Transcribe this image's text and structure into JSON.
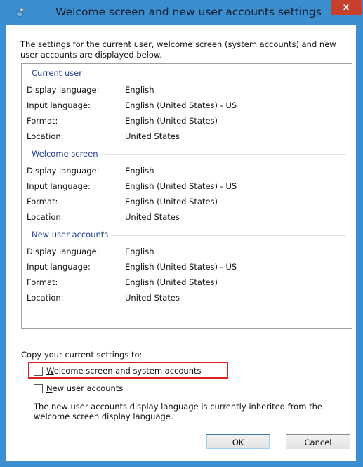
{
  "window": {
    "title": "Welcome screen and new user accounts settings",
    "close_label": "x"
  },
  "intro": {
    "prefix": "The ",
    "underlined": "s",
    "rest": "ettings for the current user, welcome screen (system accounts) and new user accounts are displayed below."
  },
  "sections": [
    {
      "title": "Current user",
      "rows": [
        {
          "label": "Display language:",
          "value": "English"
        },
        {
          "label": "Input language:",
          "value": "English (United States) - US"
        },
        {
          "label": "Format:",
          "value": "English (United States)"
        },
        {
          "label": "Location:",
          "value": "United States"
        }
      ]
    },
    {
      "title": "Welcome screen",
      "rows": [
        {
          "label": "Display language:",
          "value": "English"
        },
        {
          "label": "Input language:",
          "value": "English (United States) - US"
        },
        {
          "label": "Format:",
          "value": "English (United States)"
        },
        {
          "label": "Location:",
          "value": "United States"
        }
      ]
    },
    {
      "title": "New user accounts",
      "rows": [
        {
          "label": "Display language:",
          "value": "English"
        },
        {
          "label": "Input language:",
          "value": "English (United States) - US"
        },
        {
          "label": "Format:",
          "value": "English (United States)"
        },
        {
          "label": "Location:",
          "value": "United States"
        }
      ]
    }
  ],
  "copy": {
    "label": "Copy your current settings to:",
    "welcome": {
      "underlined": "W",
      "rest": "elcome screen and system accounts",
      "checked": false
    },
    "newuser": {
      "underlined": "N",
      "rest": "ew user accounts",
      "checked": false
    },
    "note": "The new user accounts display language is currently inherited from the welcome screen display language."
  },
  "buttons": {
    "ok": "OK",
    "cancel": "Cancel"
  },
  "colors": {
    "frame": "#3b8fd0",
    "section_title": "#1f3d93",
    "close": "#c7402b",
    "highlight": "#e02020"
  }
}
